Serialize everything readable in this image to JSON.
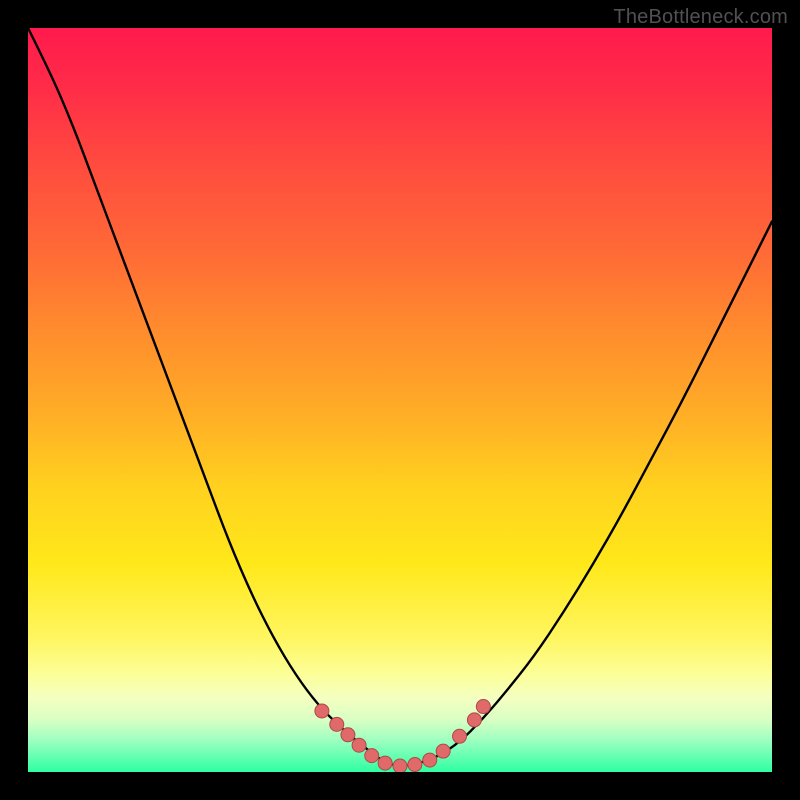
{
  "watermark": {
    "text": "TheBottleneck.com"
  },
  "colors": {
    "frame": "#000000",
    "curve": "#000000",
    "marker_fill": "#e06a6a",
    "marker_stroke": "#b04848"
  },
  "chart_data": {
    "type": "line",
    "title": "",
    "xlabel": "",
    "ylabel": "",
    "xlim": [
      0,
      1
    ],
    "ylim": [
      0,
      1
    ],
    "series": [
      {
        "name": "bottleneck-curve",
        "x": [
          0.0,
          0.03,
          0.06,
          0.09,
          0.12,
          0.15,
          0.18,
          0.21,
          0.24,
          0.27,
          0.3,
          0.33,
          0.36,
          0.39,
          0.42,
          0.45,
          0.48,
          0.5,
          0.52,
          0.55,
          0.58,
          0.61,
          0.64,
          0.68,
          0.72,
          0.76,
          0.8,
          0.84,
          0.88,
          0.92,
          0.96,
          1.0
        ],
        "y": [
          1.0,
          0.94,
          0.87,
          0.79,
          0.71,
          0.63,
          0.55,
          0.47,
          0.39,
          0.31,
          0.24,
          0.18,
          0.13,
          0.09,
          0.06,
          0.035,
          0.012,
          0.008,
          0.01,
          0.02,
          0.04,
          0.07,
          0.105,
          0.155,
          0.215,
          0.28,
          0.35,
          0.425,
          0.5,
          0.58,
          0.66,
          0.74
        ]
      }
    ],
    "markers": {
      "name": "highlight-points",
      "points": [
        {
          "x": 0.395,
          "y": 0.082
        },
        {
          "x": 0.415,
          "y": 0.064
        },
        {
          "x": 0.43,
          "y": 0.05
        },
        {
          "x": 0.445,
          "y": 0.036
        },
        {
          "x": 0.462,
          "y": 0.022
        },
        {
          "x": 0.48,
          "y": 0.012
        },
        {
          "x": 0.5,
          "y": 0.008
        },
        {
          "x": 0.52,
          "y": 0.01
        },
        {
          "x": 0.54,
          "y": 0.016
        },
        {
          "x": 0.558,
          "y": 0.028
        },
        {
          "x": 0.58,
          "y": 0.048
        },
        {
          "x": 0.6,
          "y": 0.07
        },
        {
          "x": 0.612,
          "y": 0.088
        }
      ]
    }
  }
}
